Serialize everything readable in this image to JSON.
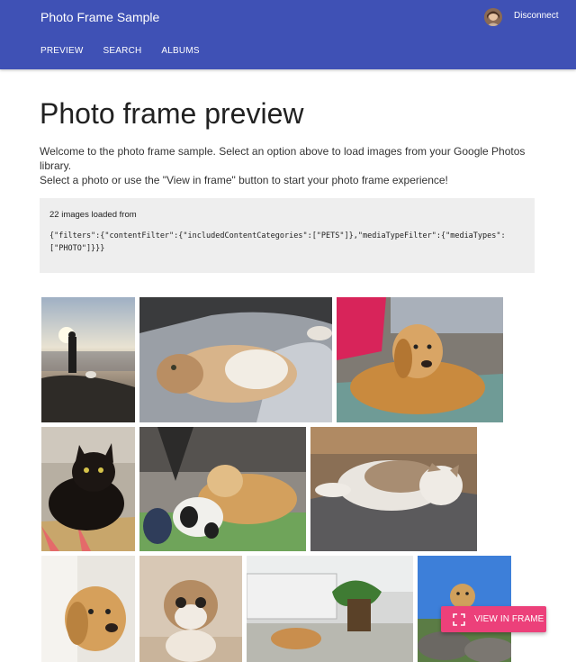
{
  "app": {
    "title": "Photo Frame Sample",
    "disconnect_label": "Disconnect"
  },
  "nav": {
    "items": [
      "PREVIEW",
      "SEARCH",
      "ALBUMS"
    ]
  },
  "page": {
    "title": "Photo frame preview",
    "intro_line1": "Welcome to the photo frame sample. Select an option above to load images from your Google Photos library.",
    "intro_line2": "Select a photo or use the \"View in frame\" button to start your photo frame experience!"
  },
  "info": {
    "loaded_text": "22 images loaded from",
    "filter_json": "{\"filters\":{\"contentFilter\":{\"includedContentCategories\":[\"PETS\"]},\"mediaTypeFilter\":{\"mediaTypes\":[\"PHOTO\"]}}}"
  },
  "photos": [
    "sunset-beach-person-dog",
    "cat-lying-on-back",
    "golden-retriever-petted",
    "black-cat-on-blanket",
    "golden-retriever-with-toy",
    "tabby-cat-lying",
    "golden-retriever-portrait",
    "scottish-fold-kitten",
    "dog-lying-in-office",
    "dog-on-rocks"
  ],
  "fab": {
    "label": "VIEW IN FRAME",
    "icon": "fullscreen-icon"
  },
  "colors": {
    "appbar": "#3f51b5",
    "accent": "#ec407a",
    "info_bg": "#eeeeee"
  }
}
